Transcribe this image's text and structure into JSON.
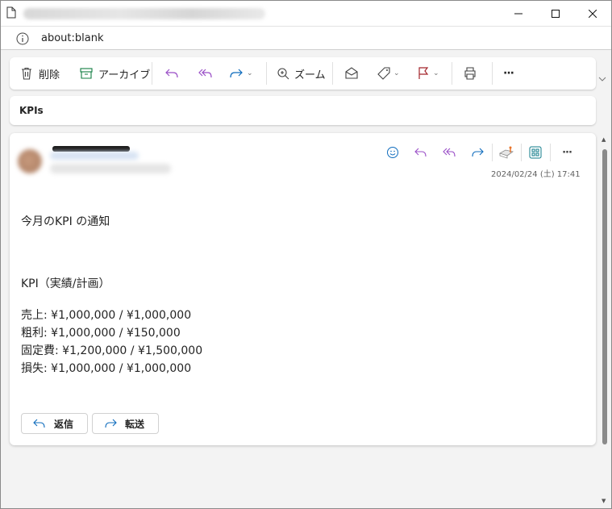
{
  "window": {
    "address": "about:blank",
    "colors": {
      "accent": "#0f6cbd",
      "reply": "#9a4fc7",
      "flag": "#a4262c",
      "archive": "#107c41"
    }
  },
  "toolbar": {
    "delete_label": "削除",
    "archive_label": "アーカイブ",
    "zoom_label": "ズーム",
    "more_label": "···"
  },
  "subject": "KPIs",
  "message": {
    "date": "2024/02/24 (土) 17:41",
    "line1": "今月のKPI の通知",
    "kpi_header": "KPI（実績/計画）",
    "kpis": [
      "売上: ¥1,000,000 / ¥1,000,000",
      "粗利: ¥1,000,000 / ¥150,000",
      "固定費: ¥1,200,000 / ¥1,500,000",
      "損失: ¥1,000,000 / ¥1,000,000"
    ],
    "more_label": "···"
  },
  "buttons": {
    "reply_label": "返信",
    "forward_label": "転送"
  }
}
